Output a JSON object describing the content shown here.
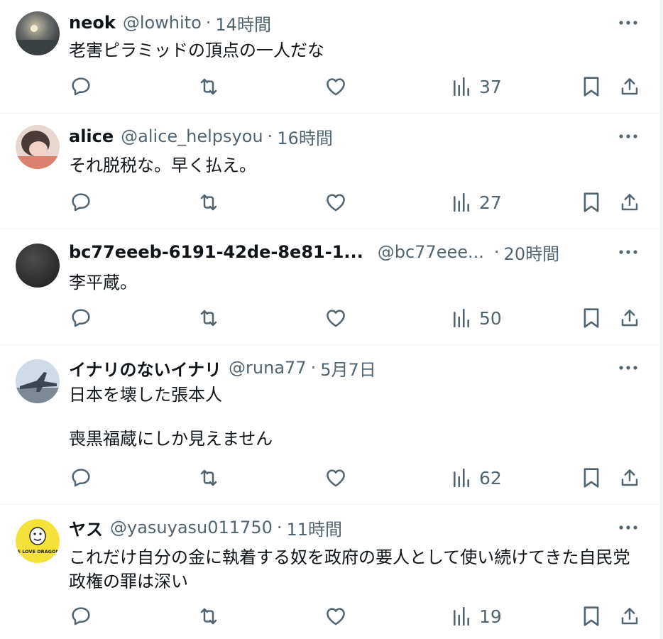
{
  "tweets": [
    {
      "name": "neok",
      "handle": "@lowhito",
      "separator": "·",
      "time": "14時間",
      "text": "老害ピラミッドの頂点の一人だな",
      "views": "37",
      "avatar_icon": "night-sky-avatar"
    },
    {
      "name": "alice",
      "handle": "@alice_helpsyou",
      "separator": "·",
      "time": "16時間",
      "text": "それ脱税な。早く払え。",
      "views": "27",
      "avatar_icon": "portrait-avatar"
    },
    {
      "name": "bc77eeeb-6191-42de-8e81-1...",
      "handle": "@bc77eee...",
      "separator": "·",
      "time": "20時間",
      "text": "李平蔵。",
      "views": "50",
      "avatar_icon": "dark-circle-avatar"
    },
    {
      "name": "イナリのないイナリ",
      "handle": "@runa77",
      "separator": "·",
      "time": "5月7日",
      "text": "日本を壊した張本人\n\n喪黒福蔵にしか見えません",
      "views": "62",
      "avatar_icon": "jet-aircraft-avatar"
    },
    {
      "name": "ヤス",
      "handle": "@yasuyasu011750",
      "separator": "·",
      "time": "11時間",
      "text": "これだけ自分の金に執着する奴を政府の要人として使い続けてきた自民党政権の罪は深い",
      "views": "19",
      "avatar_icon": "dragons-logo-avatar",
      "avatar_text": "WE LOVE DRAGONS"
    }
  ],
  "icons": {
    "reply": "reply-icon",
    "repost": "repost-icon",
    "like": "like-icon",
    "views": "views-icon",
    "bookmark": "bookmark-icon",
    "share": "share-icon",
    "more": "more-icon"
  },
  "colors": {
    "text": "#0f1419",
    "secondary": "#536471",
    "divider": "#eff3f4",
    "icon": "#536471"
  }
}
